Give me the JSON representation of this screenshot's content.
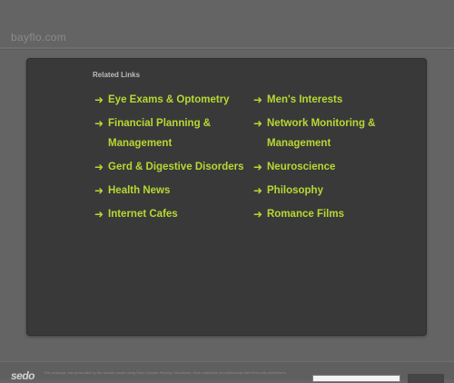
{
  "header": {
    "site_name": "bayflo.com"
  },
  "related": {
    "title": "Related Links",
    "arrow": "➜",
    "links": [
      {
        "label": "Eye Exams & Optometry"
      },
      {
        "label": "Men's Interests"
      },
      {
        "label": "Financial Planning & Management"
      },
      {
        "label": "Network Monitoring & Management"
      },
      {
        "label": "Gerd & Digestive Disorders"
      },
      {
        "label": "Neuroscience"
      },
      {
        "label": "Health News"
      },
      {
        "label": "Philosophy"
      },
      {
        "label": "Internet Cafes"
      },
      {
        "label": "Romance Films"
      }
    ]
  },
  "footer": {
    "logo": "sedo",
    "text": "This webpage was generated by the domain owner using Sedo Domain Parking. Disclaimer: Sedo maintains no relationship with third party advertisers."
  },
  "colors": {
    "background": "#646464",
    "panel": "#393939",
    "link": "#b7d833"
  }
}
